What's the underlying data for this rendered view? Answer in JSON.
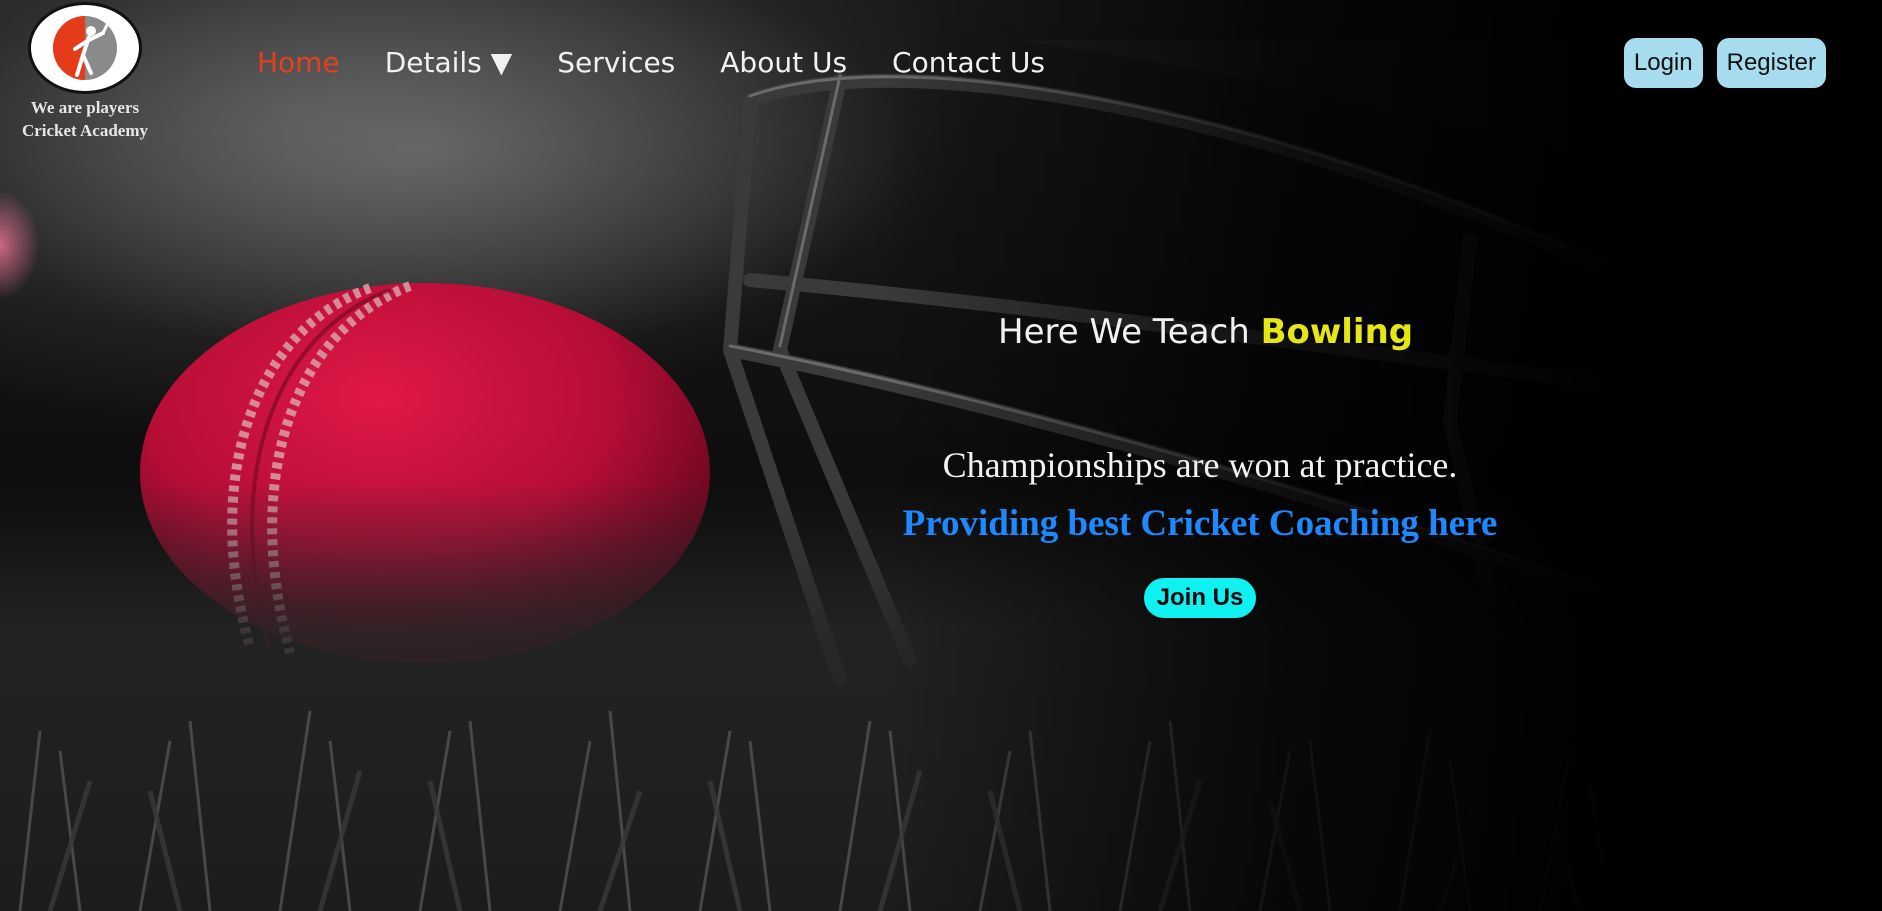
{
  "brand": {
    "logo_line1": "We are players",
    "logo_line2": "Cricket Academy",
    "logo_icon": "cricketer-logo-icon"
  },
  "nav": {
    "items": [
      {
        "label": "Home",
        "active": true
      },
      {
        "label": "Details ▼",
        "active": false
      },
      {
        "label": "Services",
        "active": false
      },
      {
        "label": "About Us",
        "active": false
      },
      {
        "label": "Contact Us",
        "active": false
      }
    ]
  },
  "auth": {
    "login_label": "Login",
    "register_label": "Register"
  },
  "hero": {
    "teach_prefix": "Here We Teach",
    "teach_highlight": "Bowling",
    "quote": "Championships are won at practice.",
    "subtitle": "Providing best Cricket Coaching here",
    "cta_label": "Join Us"
  },
  "colors": {
    "nav_active": "#e2401f",
    "highlight_yellow": "#e6e617",
    "subtitle_blue": "#1e88ff",
    "cta_cyan": "#10f2f2",
    "auth_button": "#a6dcee",
    "ball_red": "#c4123c"
  }
}
